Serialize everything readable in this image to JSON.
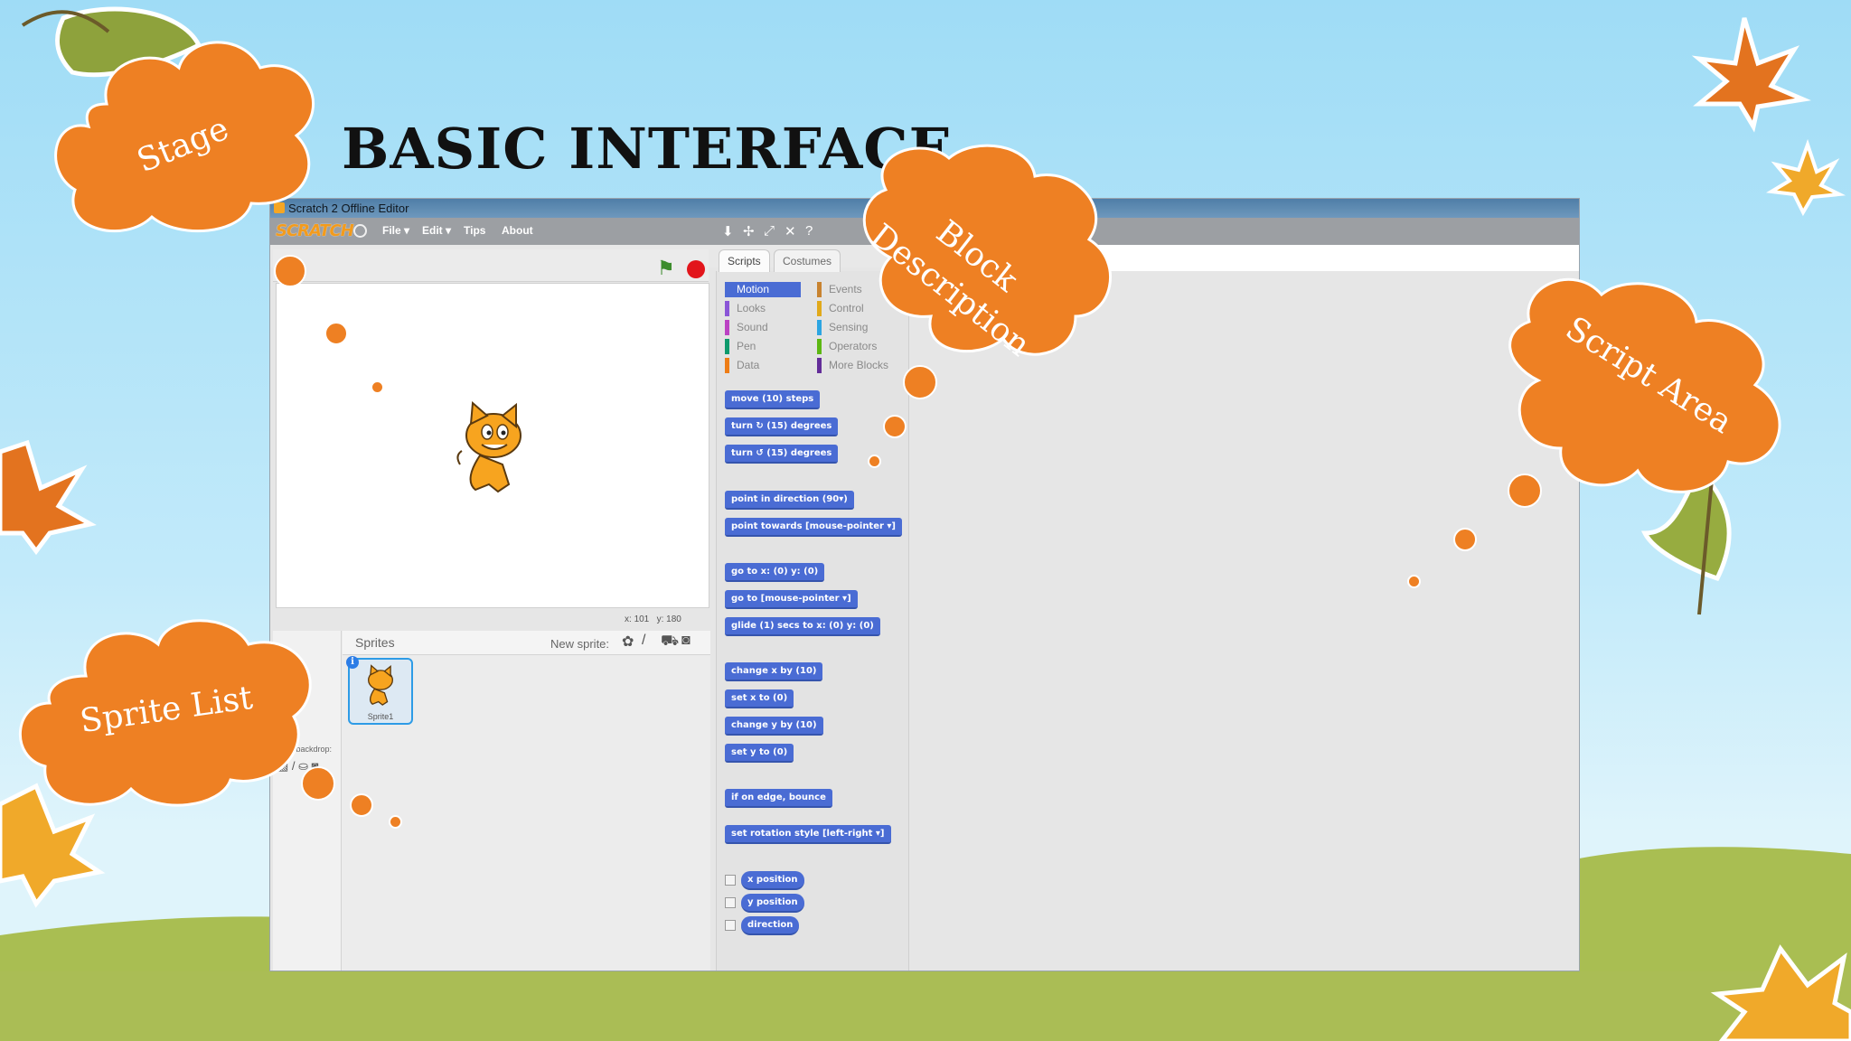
{
  "slide": {
    "title": "BASIC INTERFACE",
    "accent_color": "#ee8023",
    "callouts": {
      "stage": "Stage",
      "sprite_list": "Sprite List",
      "block_description_line1": "Block",
      "block_description_line2": "Description",
      "script_area": "Script Area"
    }
  },
  "editor": {
    "window_title": "Scratch 2 Offline Editor",
    "logo": "SCRATCH",
    "menu": [
      "File ▾",
      "Edit ▾",
      "Tips",
      "About"
    ],
    "toolbar_icons": [
      "duplicate-icon",
      "delete-icon",
      "grow-icon",
      "shrink-icon",
      "help-icon"
    ],
    "tabs": [
      "Scripts",
      "Costumes"
    ],
    "stage_coords": {
      "x_label": "x:",
      "x": "101",
      "y_label": "y:",
      "y": "180"
    },
    "sprites_label": "Sprites",
    "new_sprite_label": "New sprite:",
    "backdrop_label": "New backdrop:",
    "sprite_name": "Sprite1",
    "categories_left": [
      {
        "label": "Motion",
        "color": "#4a6cd4"
      },
      {
        "label": "Looks",
        "color": "#8a55d7"
      },
      {
        "label": "Sound",
        "color": "#bb42c3"
      },
      {
        "label": "Pen",
        "color": "#0e9a6c"
      },
      {
        "label": "Data",
        "color": "#ee7d16"
      }
    ],
    "categories_right": [
      {
        "label": "Events",
        "color": "#c88330"
      },
      {
        "label": "Control",
        "color": "#e1a91a"
      },
      {
        "label": "Sensing",
        "color": "#2ca5e2"
      },
      {
        "label": "Operators",
        "color": "#5cb712"
      },
      {
        "label": "More Blocks",
        "color": "#632d99"
      }
    ],
    "blocks": [
      {
        "text": "move (10) steps"
      },
      {
        "text": "turn ↻ (15) degrees"
      },
      {
        "text": "turn ↺ (15) degrees"
      },
      {
        "text": "point in direction (90▾)"
      },
      {
        "text": "point towards [mouse-pointer ▾]"
      },
      {
        "text": "go to x: (0) y: (0)"
      },
      {
        "text": "go to [mouse-pointer ▾]"
      },
      {
        "text": "glide (1) secs to x: (0) y: (0)"
      },
      {
        "text": "change x by (10)"
      },
      {
        "text": "set x to (0)"
      },
      {
        "text": "change y by (10)"
      },
      {
        "text": "set y to (0)"
      },
      {
        "text": "if on edge, bounce"
      },
      {
        "text": "set rotation style [left-right ▾]"
      }
    ],
    "reporters": [
      "x position",
      "y position",
      "direction"
    ]
  }
}
